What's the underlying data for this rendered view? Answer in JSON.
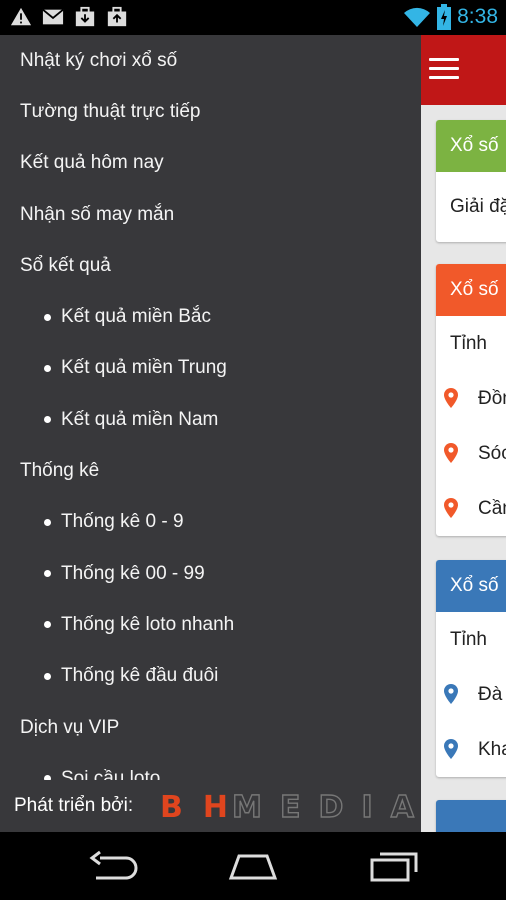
{
  "status_bar": {
    "time": "8:38"
  },
  "drawer": {
    "menu": [
      {
        "label": "Nhật ký chơi xổ số",
        "level": "top"
      },
      {
        "label": "Tường thuật trực tiếp",
        "level": "top"
      },
      {
        "label": "Kết quả hôm nay",
        "level": "top"
      },
      {
        "label": "Nhận số may mắn",
        "level": "top"
      },
      {
        "label": "Sổ kết quả",
        "level": "top"
      },
      {
        "label": "Kết quả miền Bắc",
        "level": "sub"
      },
      {
        "label": "Kết quả miền Trung",
        "level": "sub"
      },
      {
        "label": "Kết quả miền Nam",
        "level": "sub"
      },
      {
        "label": "Thống kê",
        "level": "top"
      },
      {
        "label": "Thống kê 0 - 9",
        "level": "sub"
      },
      {
        "label": "Thống kê 00 - 99",
        "level": "sub"
      },
      {
        "label": "Thống kê loto nhanh",
        "level": "sub"
      },
      {
        "label": "Thống kê đầu đuôi",
        "level": "sub"
      },
      {
        "label": "Dịch vụ VIP",
        "level": "top"
      },
      {
        "label": "Soi cầu loto",
        "level": "sub"
      }
    ],
    "footer_label": "Phát triển bởi:",
    "logo_text": "BHMEDIA"
  },
  "main": {
    "cards": [
      {
        "header": "Xổ số",
        "color": "#7cb342",
        "rows": [
          {
            "text": "Giải đặ",
            "pin": false
          }
        ]
      },
      {
        "header": "Xổ số",
        "color": "#f1592a",
        "rows": [
          {
            "text": "Tỉnh",
            "pin": false
          },
          {
            "text": "Đồn",
            "pin": true,
            "pin_color": "#f1592a"
          },
          {
            "text": "Sóc",
            "pin": true,
            "pin_color": "#f1592a"
          },
          {
            "text": "Cần",
            "pin": true,
            "pin_color": "#f1592a"
          }
        ]
      },
      {
        "header": "Xổ số",
        "color": "#3a78b8",
        "rows": [
          {
            "text": "Tỉnh",
            "pin": false
          },
          {
            "text": "Đà",
            "pin": true,
            "pin_color": "#3a78b8"
          },
          {
            "text": "Kha",
            "pin": true,
            "pin_color": "#3a78b8"
          }
        ]
      }
    ],
    "fourth_card_color": "#3a78b8"
  }
}
